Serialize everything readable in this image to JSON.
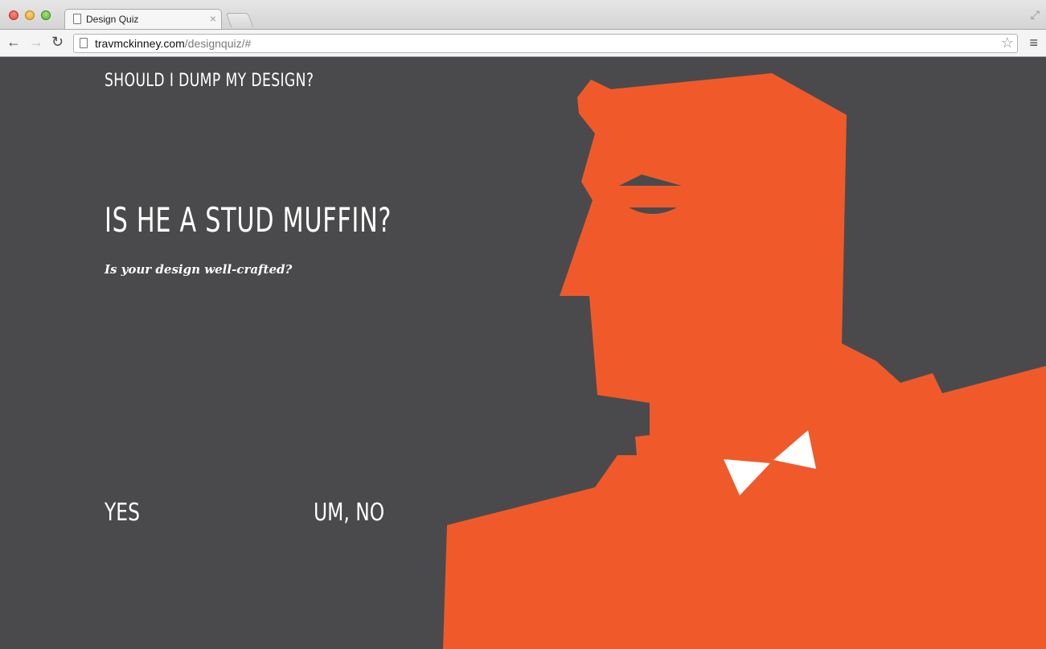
{
  "browser": {
    "tab_title": "Design Quiz",
    "tab_close": "×",
    "url_domain": "travmckinney.com",
    "url_path": "/designquiz/#"
  },
  "quiz": {
    "site_title": "SHOULD I DUMP MY DESIGN?",
    "question": "IS HE A STUD MUFFIN?",
    "subquestion": "Is your design well-crafted?",
    "answer_yes": "YES",
    "answer_no": "UM, NO"
  },
  "colors": {
    "background": "#4a4a4c",
    "accent": "#f05a2a",
    "text": "#ffffff"
  },
  "icons": [
    "back-arrow-icon",
    "forward-arrow-icon",
    "reload-icon",
    "page-icon",
    "star-icon",
    "menu-icon",
    "fullscreen-icon"
  ]
}
